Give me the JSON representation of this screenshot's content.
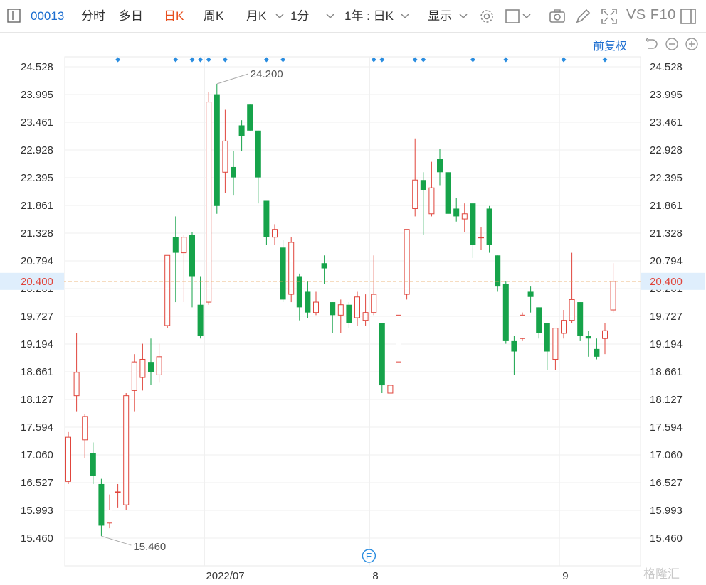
{
  "toolbar": {
    "code": "00013",
    "tabs": [
      "分时",
      "多日",
      "日K",
      "周K",
      "月K",
      "1分"
    ],
    "active_tab": "日K",
    "range": "1年 : 日K",
    "display": "显示",
    "vs_f10": "VS F10"
  },
  "adjust_label": "前复权",
  "colors": {
    "up": "#e0453c",
    "down": "#16a34a",
    "accent": "#1e6fd0",
    "current_line": "#e8a35a"
  },
  "watermark": "格隆汇",
  "chart_data": {
    "type": "candlestick",
    "y_ticks": [
      "24.528",
      "23.995",
      "23.461",
      "22.928",
      "22.395",
      "21.861",
      "21.328",
      "20.794",
      "20.261",
      "19.727",
      "19.194",
      "18.661",
      "18.127",
      "17.594",
      "17.060",
      "16.527",
      "15.993",
      "15.460"
    ],
    "ylim": [
      15.46,
      24.528
    ],
    "x_labels": [
      {
        "index": 17,
        "label": "2022/07"
      },
      {
        "index": 37,
        "label": "8"
      },
      {
        "index": 60,
        "label": "9"
      }
    ],
    "current_price": "20.400",
    "max_label": "24.200",
    "min_label": "15.460",
    "event_marker": "E",
    "candles": [
      {
        "o": 16.55,
        "h": 17.5,
        "l": 16.5,
        "c": 17.4
      },
      {
        "o": 18.2,
        "h": 19.4,
        "l": 17.9,
        "c": 18.65
      },
      {
        "o": 17.35,
        "h": 17.85,
        "l": 17.0,
        "c": 17.8
      },
      {
        "o": 17.1,
        "h": 17.3,
        "l": 16.5,
        "c": 16.65
      },
      {
        "o": 16.5,
        "h": 16.6,
        "l": 15.5,
        "c": 15.7
      },
      {
        "o": 15.75,
        "h": 16.3,
        "l": 15.65,
        "c": 16.0
      },
      {
        "o": 16.35,
        "h": 16.5,
        "l": 16.05,
        "c": 16.35
      },
      {
        "o": 16.1,
        "h": 18.25,
        "l": 16.0,
        "c": 18.2
      },
      {
        "o": 18.3,
        "h": 19.0,
        "l": 17.9,
        "c": 18.85
      },
      {
        "o": 18.55,
        "h": 19.2,
        "l": 18.3,
        "c": 18.9
      },
      {
        "o": 18.85,
        "h": 19.3,
        "l": 18.4,
        "c": 18.65
      },
      {
        "o": 18.6,
        "h": 19.2,
        "l": 18.45,
        "c": 18.95
      },
      {
        "o": 19.55,
        "h": 20.9,
        "l": 19.5,
        "c": 20.9
      },
      {
        "o": 21.25,
        "h": 21.65,
        "l": 20.0,
        "c": 20.95
      },
      {
        "o": 20.95,
        "h": 21.3,
        "l": 20.0,
        "c": 21.25
      },
      {
        "o": 21.3,
        "h": 21.35,
        "l": 19.9,
        "c": 20.5
      },
      {
        "o": 19.95,
        "h": 20.5,
        "l": 19.3,
        "c": 19.35
      },
      {
        "o": 20.0,
        "h": 24.05,
        "l": 19.95,
        "c": 23.85
      },
      {
        "o": 24.0,
        "h": 24.2,
        "l": 21.7,
        "c": 21.85
      },
      {
        "o": 22.5,
        "h": 23.7,
        "l": 22.1,
        "c": 23.1
      },
      {
        "o": 22.6,
        "h": 22.9,
        "l": 22.05,
        "c": 22.4
      },
      {
        "o": 23.4,
        "h": 23.5,
        "l": 22.9,
        "c": 23.2
      },
      {
        "o": 23.8,
        "h": 23.8,
        "l": 23.3,
        "c": 23.3
      },
      {
        "o": 23.3,
        "h": 23.3,
        "l": 21.9,
        "c": 22.4
      },
      {
        "o": 21.95,
        "h": 21.95,
        "l": 21.1,
        "c": 21.25
      },
      {
        "o": 21.25,
        "h": 21.5,
        "l": 21.1,
        "c": 21.4
      },
      {
        "o": 21.05,
        "h": 21.2,
        "l": 20.0,
        "c": 20.05
      },
      {
        "o": 20.15,
        "h": 21.25,
        "l": 20.0,
        "c": 21.15
      },
      {
        "o": 20.5,
        "h": 20.55,
        "l": 19.65,
        "c": 19.9
      },
      {
        "o": 20.2,
        "h": 20.4,
        "l": 19.7,
        "c": 19.8
      },
      {
        "o": 19.8,
        "h": 20.2,
        "l": 19.75,
        "c": 20.0
      },
      {
        "o": 20.75,
        "h": 20.9,
        "l": 20.35,
        "c": 20.65
      },
      {
        "o": 20.0,
        "h": 20.0,
        "l": 19.4,
        "c": 19.75
      },
      {
        "o": 19.75,
        "h": 20.05,
        "l": 19.4,
        "c": 19.95
      },
      {
        "o": 19.95,
        "h": 20.0,
        "l": 19.5,
        "c": 19.6
      },
      {
        "o": 19.7,
        "h": 20.2,
        "l": 19.55,
        "c": 20.1
      },
      {
        "o": 19.65,
        "h": 20.15,
        "l": 19.55,
        "c": 19.8
      },
      {
        "o": 19.8,
        "h": 20.9,
        "l": 19.75,
        "c": 20.15
      },
      {
        "o": 19.6,
        "h": 19.6,
        "l": 18.25,
        "c": 18.4
      },
      {
        "o": 18.25,
        "h": 18.4,
        "l": 18.25,
        "c": 18.4
      },
      {
        "o": 18.85,
        "h": 19.75,
        "l": 18.85,
        "c": 19.75
      },
      {
        "o": 20.15,
        "h": 21.4,
        "l": 20.05,
        "c": 21.4
      },
      {
        "o": 21.8,
        "h": 23.15,
        "l": 21.65,
        "c": 22.35
      },
      {
        "o": 22.35,
        "h": 22.5,
        "l": 21.3,
        "c": 22.15
      },
      {
        "o": 21.7,
        "h": 22.7,
        "l": 21.65,
        "c": 22.2
      },
      {
        "o": 22.75,
        "h": 22.95,
        "l": 22.25,
        "c": 22.5
      },
      {
        "o": 22.5,
        "h": 22.5,
        "l": 21.7,
        "c": 21.7
      },
      {
        "o": 21.8,
        "h": 22.0,
        "l": 21.55,
        "c": 21.65
      },
      {
        "o": 21.6,
        "h": 21.9,
        "l": 21.35,
        "c": 21.7
      },
      {
        "o": 21.9,
        "h": 21.9,
        "l": 20.85,
        "c": 21.1
      },
      {
        "o": 21.25,
        "h": 21.45,
        "l": 21.0,
        "c": 21.25
      },
      {
        "o": 21.8,
        "h": 21.85,
        "l": 20.95,
        "c": 21.1
      },
      {
        "o": 20.9,
        "h": 20.9,
        "l": 20.2,
        "c": 20.3
      },
      {
        "o": 20.35,
        "h": 20.4,
        "l": 19.2,
        "c": 19.25
      },
      {
        "o": 19.25,
        "h": 19.35,
        "l": 18.6,
        "c": 19.05
      },
      {
        "o": 19.3,
        "h": 19.8,
        "l": 19.25,
        "c": 19.75
      },
      {
        "o": 20.2,
        "h": 20.3,
        "l": 19.8,
        "c": 20.1
      },
      {
        "o": 19.9,
        "h": 19.9,
        "l": 19.3,
        "c": 19.4
      },
      {
        "o": 19.6,
        "h": 19.6,
        "l": 18.7,
        "c": 19.05
      },
      {
        "o": 18.9,
        "h": 19.5,
        "l": 18.7,
        "c": 19.5
      },
      {
        "o": 19.4,
        "h": 19.85,
        "l": 19.3,
        "c": 19.65
      },
      {
        "o": 19.65,
        "h": 20.95,
        "l": 19.6,
        "c": 20.05
      },
      {
        "o": 20.0,
        "h": 20.0,
        "l": 19.25,
        "c": 19.35
      },
      {
        "o": 19.35,
        "h": 19.45,
        "l": 18.95,
        "c": 19.3
      },
      {
        "o": 19.1,
        "h": 19.3,
        "l": 18.9,
        "c": 18.95
      },
      {
        "o": 19.3,
        "h": 19.6,
        "l": 19.0,
        "c": 19.45
      },
      {
        "o": 19.85,
        "h": 20.75,
        "l": 19.8,
        "c": 20.4
      }
    ],
    "event_dots": [
      6,
      13,
      15,
      16,
      17,
      19,
      24,
      26,
      37,
      38,
      42,
      43,
      49,
      53,
      60,
      65
    ]
  }
}
